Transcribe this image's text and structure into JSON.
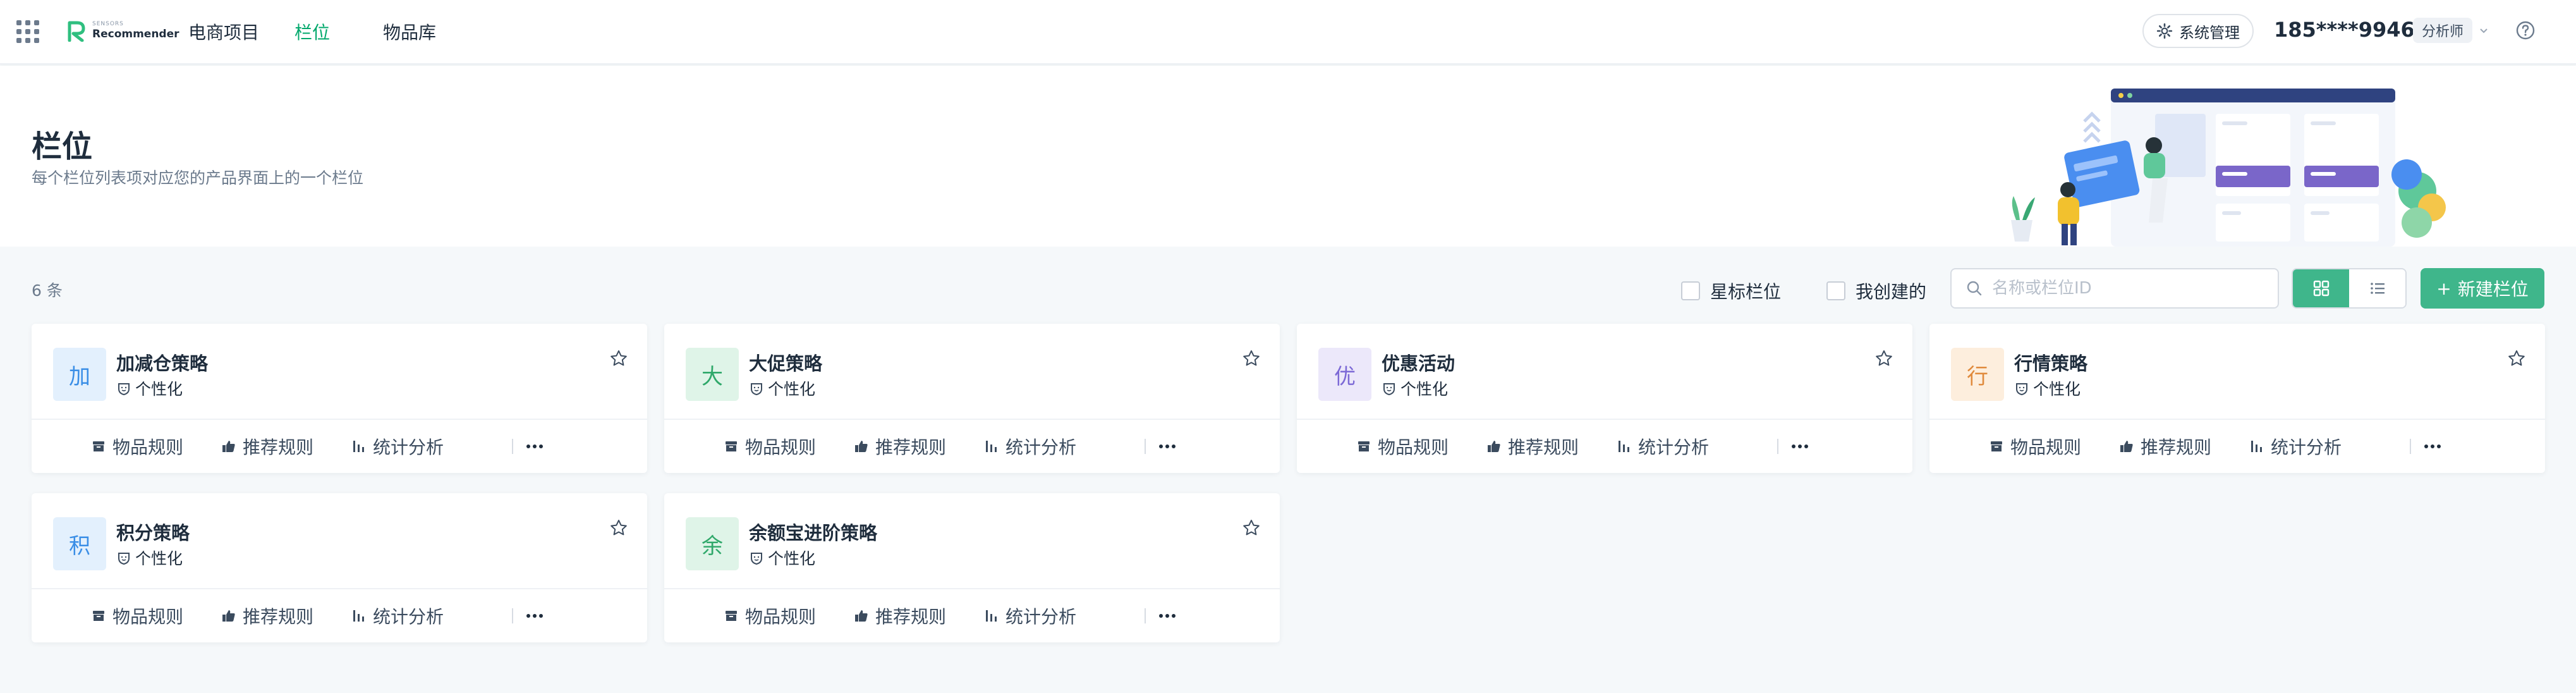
{
  "nav": {
    "logo_small": "SENSORS",
    "logo_main": "Recommender",
    "items": [
      {
        "label": "电商项目"
      },
      {
        "label": "栏位"
      },
      {
        "label": "物品库"
      }
    ],
    "active_color": "#00a86b",
    "system_label": "系统管理",
    "user_phone": "185****9946",
    "role": "分析师"
  },
  "header": {
    "title": "栏位",
    "subtitle": "每个栏位列表项对应您的产品界面上的一个栏位"
  },
  "toolbar": {
    "count": "6 条",
    "filter_starred": "星标栏位",
    "filter_mine": "我创建的",
    "search_placeholder": "名称或栏位ID",
    "view_mode": "grid",
    "new_label": "新建栏位",
    "accent_color": "#3fb68b"
  },
  "card_actions": [
    "物品规则",
    "推荐规则",
    "统计分析"
  ],
  "cards": [
    {
      "avatar": "加",
      "name": "加减仓策略",
      "tag": "个性化",
      "avatar_bg": "#e3f0fd",
      "avatar_fg": "#3a8ee6"
    },
    {
      "avatar": "大",
      "name": "大促策略",
      "tag": "个性化",
      "avatar_bg": "#dff4e8",
      "avatar_fg": "#2fa86a"
    },
    {
      "avatar": "优",
      "name": "优惠活动",
      "tag": "个性化",
      "avatar_bg": "#ece8fa",
      "avatar_fg": "#7c69d6"
    },
    {
      "avatar": "行",
      "name": "行情策略",
      "tag": "个性化",
      "avatar_bg": "#fdeedd",
      "avatar_fg": "#e08a3c"
    },
    {
      "avatar": "积",
      "name": "积分策略",
      "tag": "个性化",
      "avatar_bg": "#e3f0fd",
      "avatar_fg": "#3a8ee6"
    },
    {
      "avatar": "余",
      "name": "余额宝进阶策略",
      "tag": "个性化",
      "avatar_bg": "#dff4e8",
      "avatar_fg": "#2fa86a"
    }
  ]
}
